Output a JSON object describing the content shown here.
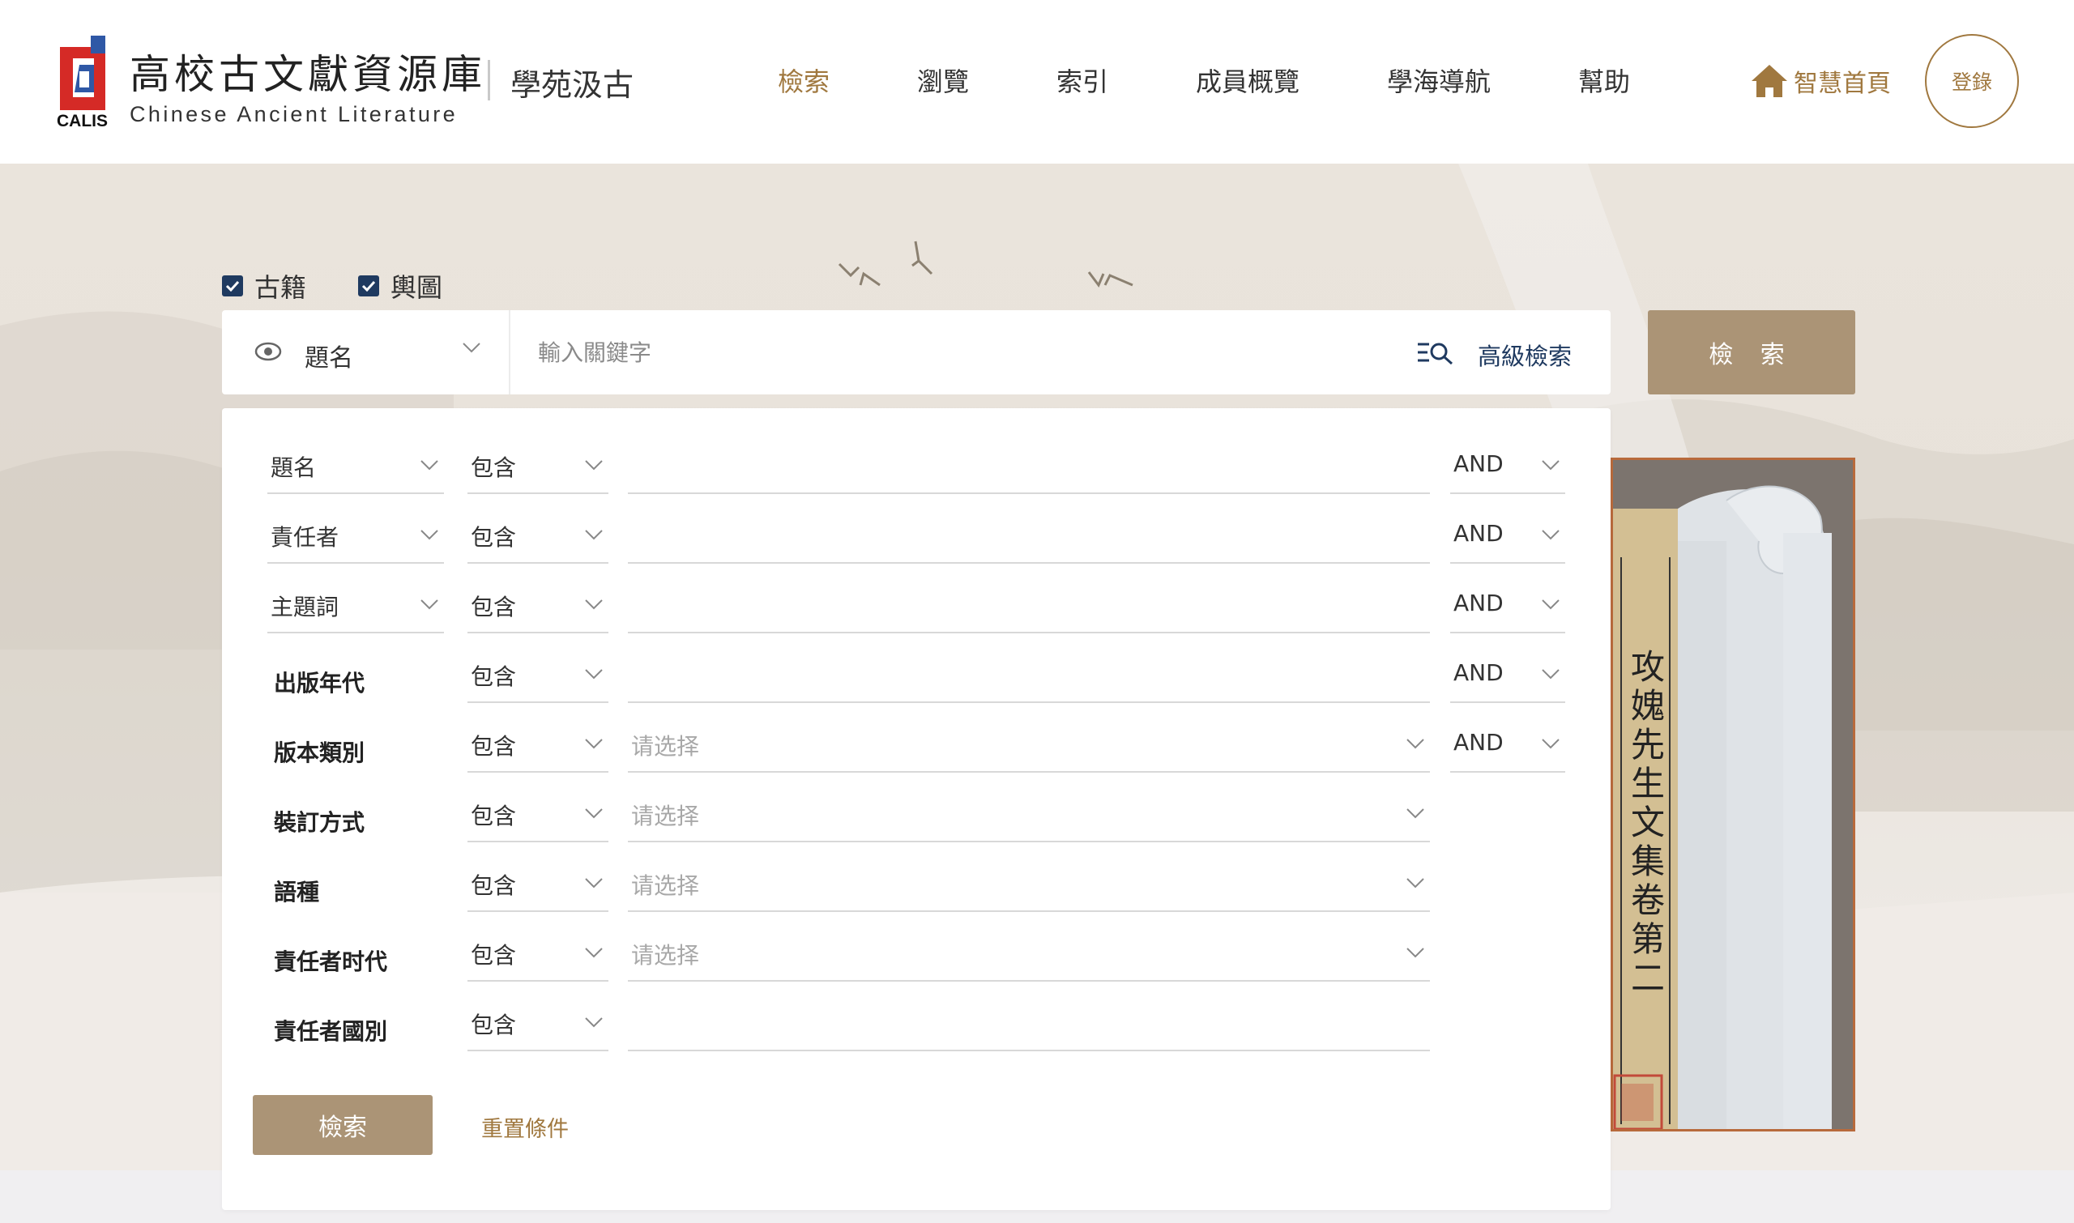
{
  "header": {
    "logo_title": "高校古文獻資源庫",
    "logo_subtitle": "Chinese Ancient Literature",
    "logo_mark_text": "CALIS",
    "slogan": "學苑汲古",
    "nav": [
      {
        "label": "檢索",
        "active": true
      },
      {
        "label": "瀏覽",
        "active": false
      },
      {
        "label": "索引",
        "active": false
      },
      {
        "label": "成員概覽",
        "active": false
      },
      {
        "label": "學海導航",
        "active": false
      },
      {
        "label": "幫助",
        "active": false
      }
    ],
    "home_link": "智慧首頁",
    "login": "登錄"
  },
  "sources": [
    {
      "label": "古籍",
      "checked": true
    },
    {
      "label": "輿圖",
      "checked": true
    }
  ],
  "searchbar": {
    "field": "題名",
    "placeholder": "輸入關鍵字",
    "advanced_label": "高級檢索",
    "submit_label": "檢 索"
  },
  "advanced": {
    "rows": [
      {
        "field": "題名",
        "field_selectable": true,
        "match": "包含",
        "value_placeholder": "",
        "value_is_select": false,
        "op": "AND"
      },
      {
        "field": "責任者",
        "field_selectable": true,
        "match": "包含",
        "value_placeholder": "",
        "value_is_select": false,
        "op": "AND"
      },
      {
        "field": "主題詞",
        "field_selectable": true,
        "match": "包含",
        "value_placeholder": "",
        "value_is_select": false,
        "op": "AND"
      },
      {
        "field": "出版年代",
        "field_selectable": false,
        "match": "包含",
        "value_placeholder": "",
        "value_is_select": false,
        "op": "AND"
      },
      {
        "field": "版本類別",
        "field_selectable": false,
        "match": "包含",
        "value_placeholder": "请选择",
        "value_is_select": true,
        "op": "AND"
      },
      {
        "field": "裝訂方式",
        "field_selectable": false,
        "match": "包含",
        "value_placeholder": "请选择",
        "value_is_select": true,
        "op": ""
      },
      {
        "field": "語種",
        "field_selectable": false,
        "match": "包含",
        "value_placeholder": "请选择",
        "value_is_select": true,
        "op": ""
      },
      {
        "field": "責任者时代",
        "field_selectable": false,
        "match": "包含",
        "value_placeholder": "请选择",
        "value_is_select": true,
        "op": ""
      },
      {
        "field": "責任者國別",
        "field_selectable": false,
        "match": "包含",
        "value_placeholder": "",
        "value_is_select": false,
        "op": ""
      }
    ],
    "search_button": "檢索",
    "reset_link": "重置條件"
  },
  "book_image": {
    "title_text": "攻媿先生文集卷第二"
  },
  "colors": {
    "accent": "#a0783f",
    "button": "#ab9476",
    "navy": "#1f3a60",
    "logo_red": "#d52a26",
    "logo_blue": "#2f58a6"
  }
}
